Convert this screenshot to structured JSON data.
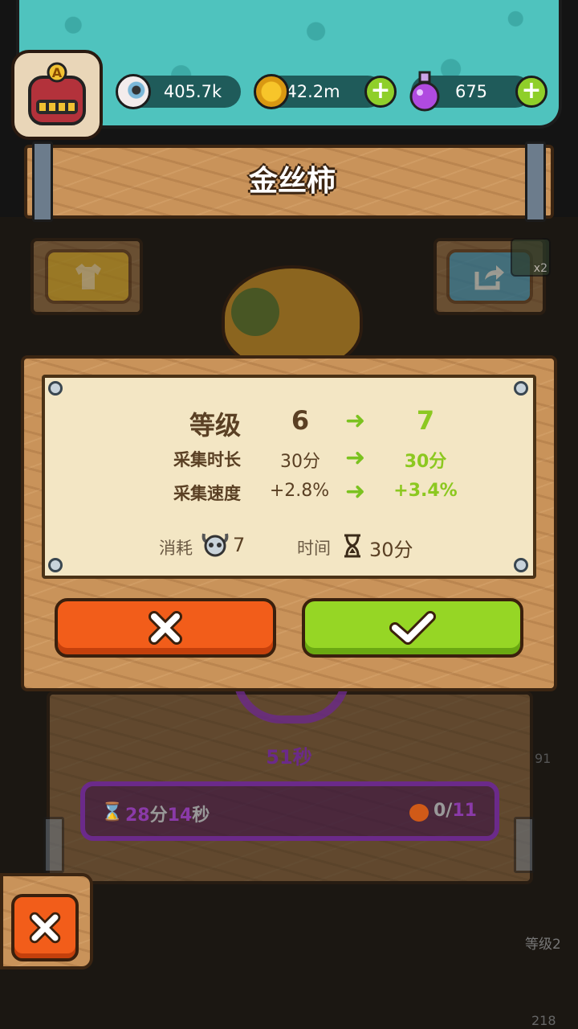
{
  "resources": {
    "eyeballs": "405.7k",
    "coins": "42.2m",
    "potions": "675"
  },
  "avatar": {
    "rank_letter": "A"
  },
  "plant_name": "金丝柿",
  "share_badge": "x2",
  "upgrade": {
    "level_label": "等级",
    "level_from": "6",
    "level_to": "7",
    "duration_label": "采集时长",
    "duration_from": "30分",
    "duration_to": "30分",
    "speed_label": "采集速度",
    "speed_from": "+2.8%",
    "speed_to": "+3.4%",
    "cost_label": "消耗",
    "cost_value": "7",
    "time_label": "时间",
    "time_value": "30分"
  },
  "background": {
    "timer_small": "51秒",
    "side_number": "91",
    "progress_time_min": "28",
    "progress_time_min_unit": "分",
    "progress_time_sec": "14",
    "progress_time_sec_unit": "秒",
    "harvest_count": "0/",
    "harvest_max": "11",
    "level_badge": "等级2",
    "bottom_number": "218"
  },
  "colors": {
    "teal": "#4fc3be",
    "wood": "#c9935a",
    "cancel": "#f25d1a",
    "confirm": "#96d625",
    "green_text": "#8cc820"
  }
}
